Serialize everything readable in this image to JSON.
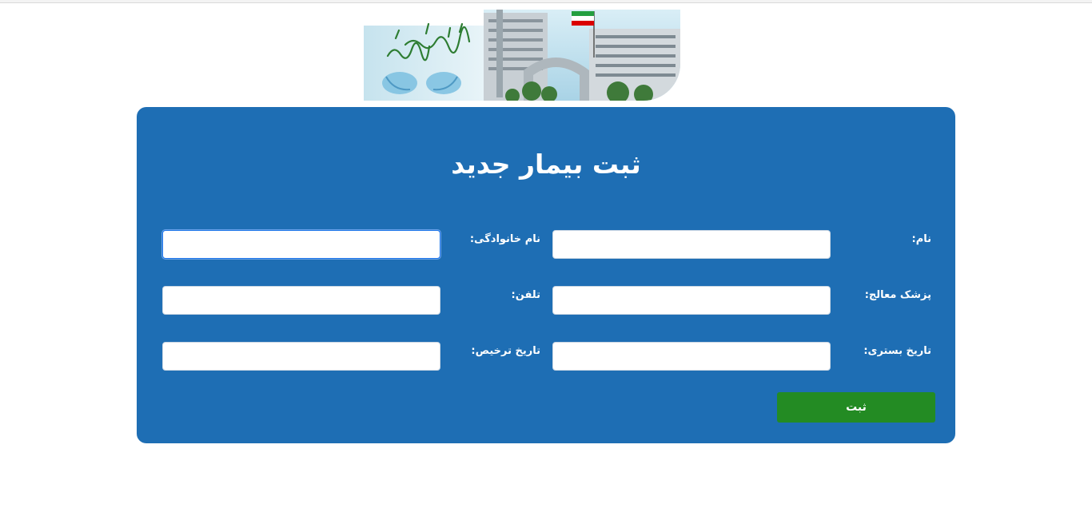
{
  "banner": {
    "calligraphy_text": "با کیمیای دانش رسم شفا",
    "flag_colors": [
      "#239f40",
      "#ffffff",
      "#da0000"
    ]
  },
  "form": {
    "title": "ثبت بیمار جدید",
    "labels": {
      "first_name": "نام:",
      "last_name": "نام خانوادگی:",
      "doctor": "پزشک معالج:",
      "phone": "تلفن:",
      "admission_date": "تاریخ بستری:",
      "discharge_date": "تاریخ ترخیص:"
    },
    "values": {
      "first_name": "",
      "last_name": "",
      "doctor": "",
      "phone": "",
      "admission_date": "",
      "discharge_date": ""
    },
    "submit_label": "ثبت"
  },
  "colors": {
    "card_background": "#1e6eb4",
    "submit_button": "#238b23",
    "focus_ring": "#1a73e8"
  }
}
